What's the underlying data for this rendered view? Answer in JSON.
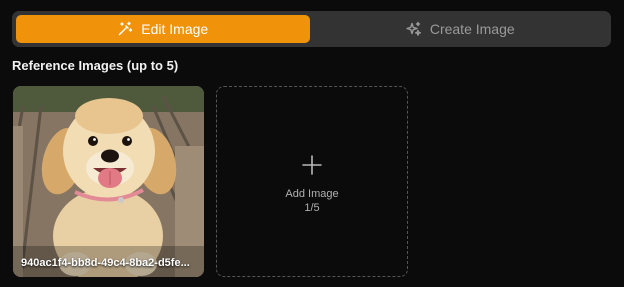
{
  "tabs": {
    "edit_label": "Edit Image",
    "create_label": "Create Image"
  },
  "reference": {
    "title": "Reference Images (up to 5)",
    "images": [
      {
        "filename": "940ac1f4-bb8d-49c4-8ba2-d5fe..."
      }
    ],
    "add_label": "Add Image",
    "add_count": "1/5"
  },
  "icons": {
    "edit_tab": "magic-wand-icon",
    "create_tab": "sparkles-icon",
    "add": "plus-icon"
  },
  "colors": {
    "accent": "#f0930a",
    "background": "#0b0b0b",
    "tab_bar": "#333333"
  }
}
